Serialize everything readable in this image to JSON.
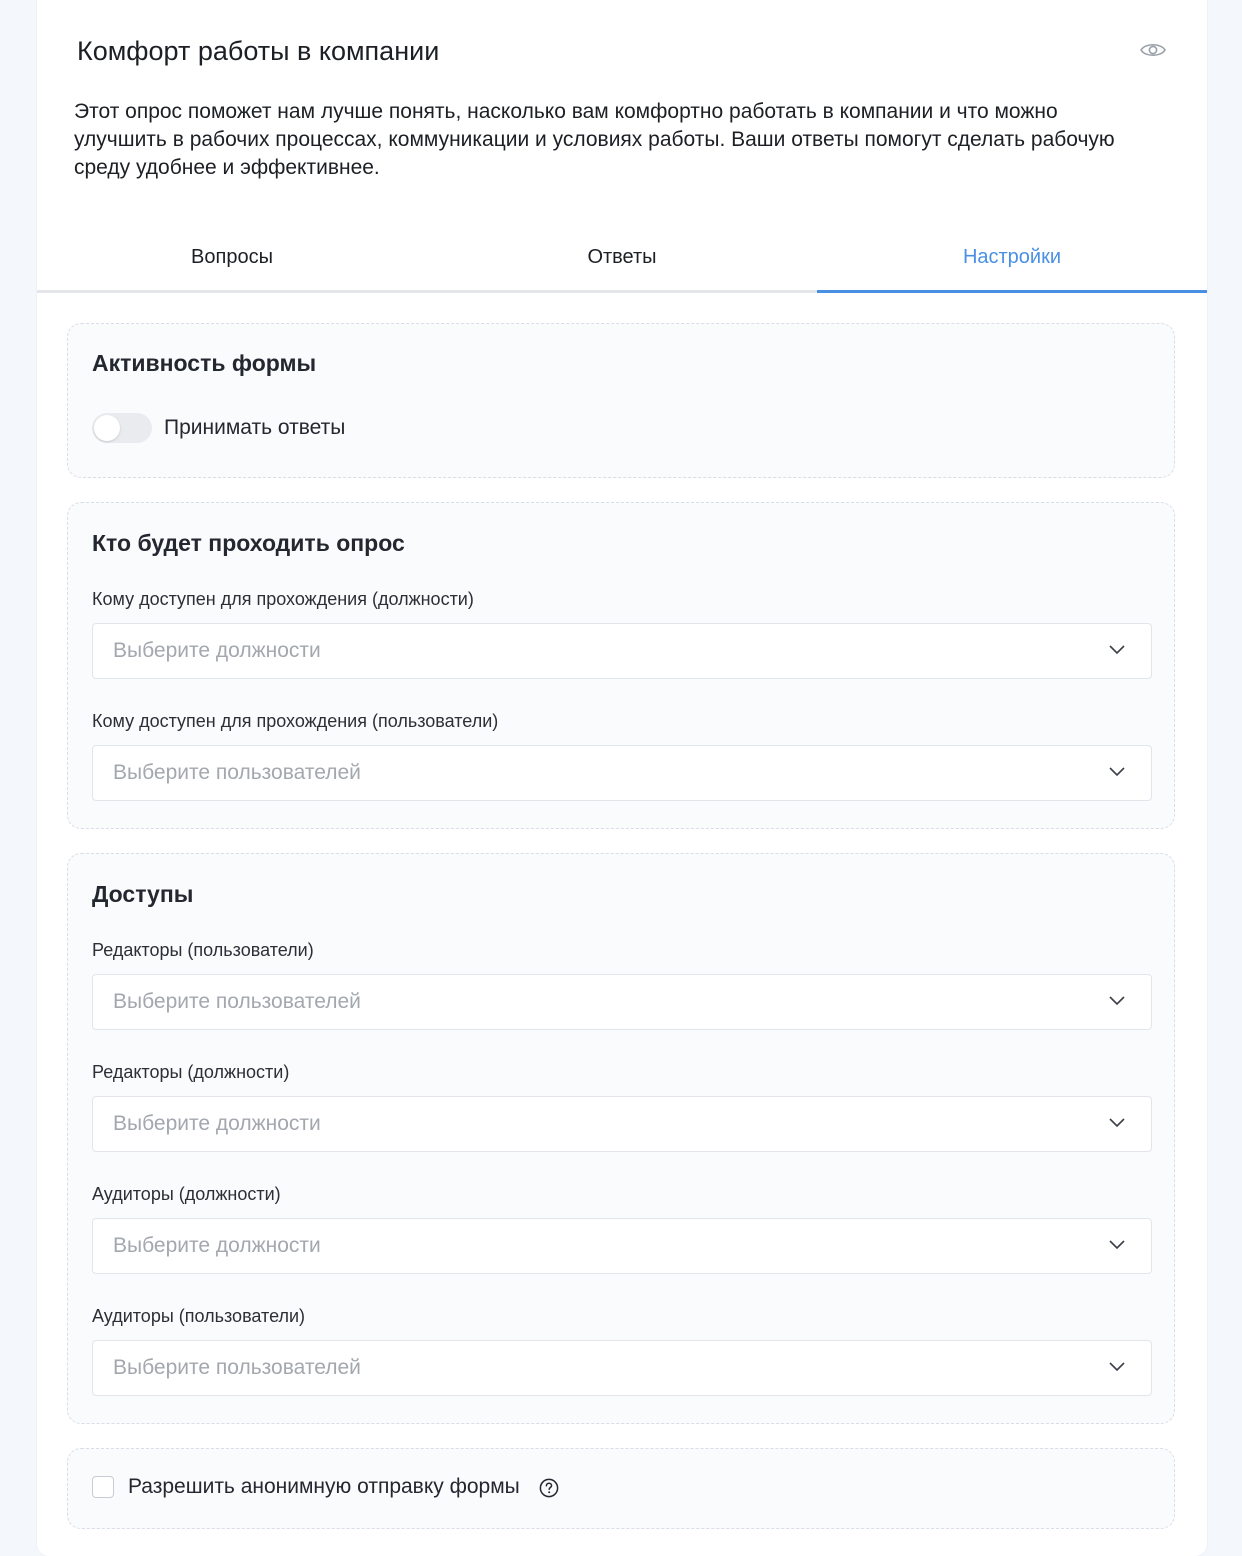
{
  "header": {
    "title": "Комфорт работы в компании",
    "description": "Этот опрос поможет нам лучше понять, насколько вам комфортно работать в компании и что можно улучшить в рабочих процессах, коммуникации и условиях работы. Ваши ответы помогут сделать рабочую среду удобнее и эффективнее.",
    "preview_icon": "eye-icon"
  },
  "tabs": [
    {
      "label": "Вопросы",
      "active": false
    },
    {
      "label": "Ответы",
      "active": false
    },
    {
      "label": "Настройки",
      "active": true
    }
  ],
  "accent_color": "#4a90e2",
  "activity": {
    "title": "Активность формы",
    "toggle_label": "Принимать ответы",
    "toggle_on": false
  },
  "participants": {
    "title": "Кто будет проходить опрос",
    "fields": [
      {
        "label": "Кому доступен для прохождения (должности)",
        "placeholder": "Выберите должности"
      },
      {
        "label": "Кому доступен для прохождения (пользователи)",
        "placeholder": "Выберите пользователей"
      }
    ]
  },
  "access": {
    "title": "Доступы",
    "fields": [
      {
        "label": "Редакторы (пользователи)",
        "placeholder": "Выберите пользователей"
      },
      {
        "label": "Редакторы (должности)",
        "placeholder": "Выберите должности"
      },
      {
        "label": "Аудиторы (должности)",
        "placeholder": "Выберите должности"
      },
      {
        "label": "Аудиторы (пользователи)",
        "placeholder": "Выберите пользователей"
      }
    ]
  },
  "anonymous": {
    "label": "Разрешить анонимную отправку формы",
    "checked": false,
    "help_icon": "question-circle-icon"
  }
}
